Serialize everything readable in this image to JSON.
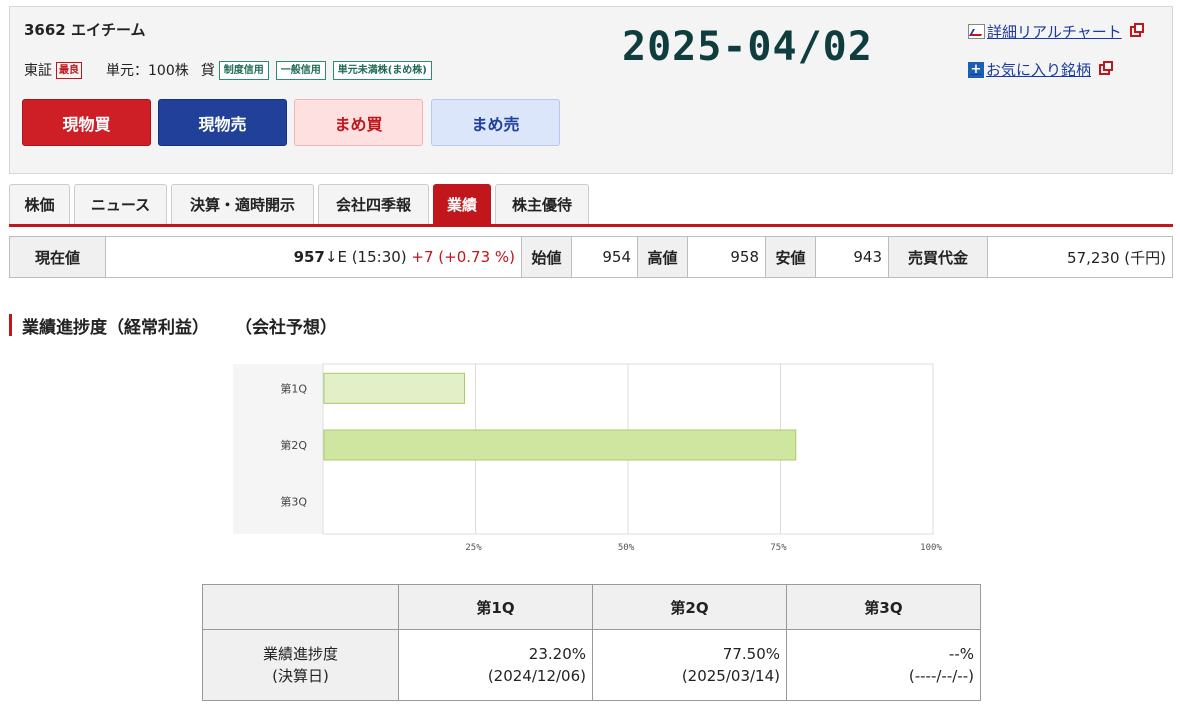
{
  "stock": {
    "title": "3662 エイチーム",
    "market": "東証",
    "best_badge": "最良",
    "unit": "単元：100株",
    "kashi": "貸",
    "tags": [
      "制度信用",
      "一般信用",
      "単元未満株(まめ株)"
    ]
  },
  "buttons": {
    "buy": "現物買",
    "sell": "現物売",
    "mame_buy": "まめ買",
    "mame_sell": "まめ売"
  },
  "date_display": "2025-04/02",
  "links": {
    "chart": "詳細リアルチャート",
    "favorite": "お気に入り銘柄"
  },
  "tabs": [
    {
      "label": "株価",
      "active": false
    },
    {
      "label": "ニュース",
      "active": false
    },
    {
      "label": "決算・適時開示",
      "active": false
    },
    {
      "label": "会社四季報",
      "active": false
    },
    {
      "label": "業績",
      "active": true
    },
    {
      "label": "株主優待",
      "active": false
    }
  ],
  "quote": {
    "current_label": "現在値",
    "current_price": "957",
    "arrow": "↓E",
    "time": "(15:30)",
    "change": "+7 (+0.73 %)",
    "open_label": "始値",
    "open": "954",
    "high_label": "高値",
    "high": "958",
    "low_label": "安値",
    "low": "943",
    "turnover_label": "売買代金",
    "turnover": "57,230 (千円)"
  },
  "section": {
    "title": "業績進捗度（経常利益）",
    "subtitle": "（会社予想）"
  },
  "chart_data": {
    "type": "bar",
    "orientation": "horizontal",
    "categories": [
      "第1Q",
      "第2Q",
      "第3Q"
    ],
    "values": [
      23.2,
      77.5,
      null
    ],
    "xlim": [
      0,
      100
    ],
    "x_ticks": [
      "25%",
      "50%",
      "75%",
      "100%"
    ],
    "x_tick_values": [
      25,
      50,
      75,
      100
    ],
    "grid": true,
    "colors": [
      "#e2efc7",
      "#cfe6a0"
    ],
    "bar_stroke": "#a9cc6b"
  },
  "progress_table": {
    "headers": [
      "",
      "第1Q",
      "第2Q",
      "第3Q"
    ],
    "row_label_1": "業績進捗度",
    "row_label_2": "(決算日)",
    "cells": [
      {
        "value": "23.20%",
        "date": "(2024/12/06)"
      },
      {
        "value": "77.50%",
        "date": "(2025/03/14)"
      },
      {
        "value": "--%",
        "date": "(----/--/--)"
      }
    ]
  }
}
